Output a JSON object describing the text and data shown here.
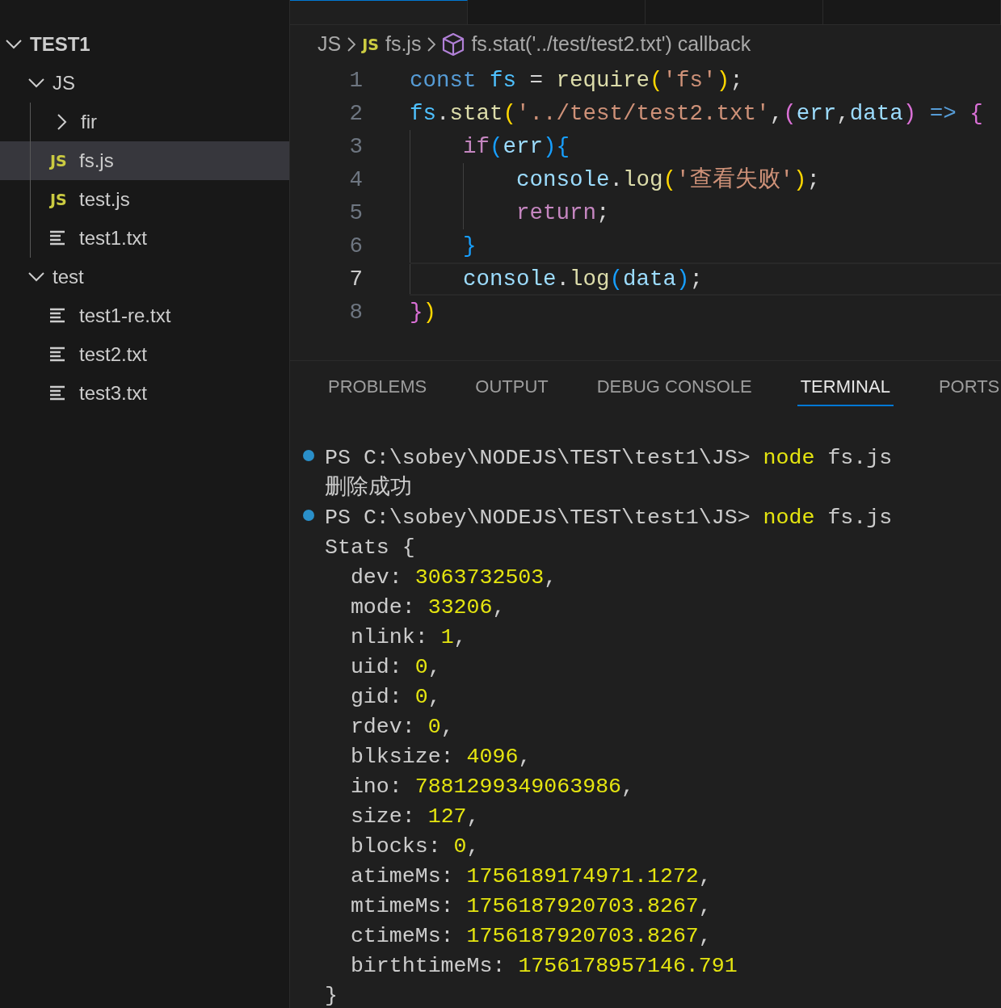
{
  "editor_tabs": [
    {
      "selected": true
    },
    {
      "selected": false
    },
    {
      "selected": false
    },
    {
      "selected": false
    }
  ],
  "explorer": {
    "root": {
      "label": "TEST1",
      "kind": "folder",
      "expanded": true,
      "selected": false,
      "children": [
        {
          "label": "JS",
          "kind": "folder",
          "expanded": true,
          "selected": false,
          "children": [
            {
              "label": "fir",
              "kind": "folder",
              "expanded": false,
              "selected": false
            },
            {
              "label": "fs.js",
              "kind": "js",
              "icon_text": "JS",
              "selected": true
            },
            {
              "label": "test.js",
              "kind": "js",
              "icon_text": "JS",
              "selected": false
            },
            {
              "label": "test1.txt",
              "kind": "txt",
              "selected": false
            }
          ]
        },
        {
          "label": "test",
          "kind": "folder",
          "expanded": true,
          "selected": false,
          "children": [
            {
              "label": "test1-re.txt",
              "kind": "txt",
              "selected": false
            },
            {
              "label": "test2.txt",
              "kind": "txt",
              "selected": false
            },
            {
              "label": "test3.txt",
              "kind": "txt",
              "selected": false
            }
          ]
        }
      ]
    }
  },
  "breadcrumb": [
    {
      "label": "JS",
      "kind": "folder"
    },
    {
      "label": "fs.js",
      "kind": "js",
      "icon_text": "JS"
    },
    {
      "label": "fs.stat('../test/test2.txt') callback",
      "kind": "symbol"
    }
  ],
  "code": {
    "lines": [
      {
        "number": "1",
        "current": false,
        "tokens": [
          {
            "t": "const ",
            "kind": "keyword"
          },
          {
            "t": "fs",
            "kind": "constant"
          },
          {
            "t": " = ",
            "kind": "plain"
          },
          {
            "t": "require",
            "kind": "function"
          },
          {
            "t": "(",
            "kind": "bracket1"
          },
          {
            "t": "'fs'",
            "kind": "string"
          },
          {
            "t": ")",
            "kind": "bracket1"
          },
          {
            "t": ";",
            "kind": "plain"
          }
        ]
      },
      {
        "number": "2",
        "current": false,
        "tokens": [
          {
            "t": "fs",
            "kind": "constant"
          },
          {
            "t": ".",
            "kind": "plain"
          },
          {
            "t": "stat",
            "kind": "function"
          },
          {
            "t": "(",
            "kind": "bracket1"
          },
          {
            "t": "'../test/test2.txt'",
            "kind": "string"
          },
          {
            "t": ",",
            "kind": "plain"
          },
          {
            "t": "(",
            "kind": "bracket2"
          },
          {
            "t": "err",
            "kind": "variable"
          },
          {
            "t": ",",
            "kind": "plain"
          },
          {
            "t": "data",
            "kind": "variable"
          },
          {
            "t": ")",
            "kind": "bracket2"
          },
          {
            "t": " =>",
            "kind": "keyword"
          },
          {
            "t": " {",
            "kind": "bracket2"
          }
        ],
        "children": [
          {
            "number": "3",
            "current": false,
            "tokens": [
              {
                "t": "if",
                "kind": "control"
              },
              {
                "t": "(",
                "kind": "bracket3"
              },
              {
                "t": "err",
                "kind": "variable"
              },
              {
                "t": ")",
                "kind": "bracket3"
              },
              {
                "t": "{",
                "kind": "bracket3"
              }
            ],
            "children": [
              {
                "number": "4",
                "current": false,
                "tokens": [
                  {
                    "t": "console",
                    "kind": "variable"
                  },
                  {
                    "t": ".",
                    "kind": "plain"
                  },
                  {
                    "t": "log",
                    "kind": "function"
                  },
                  {
                    "t": "(",
                    "kind": "bracket1"
                  },
                  {
                    "t": "'查看失败'",
                    "kind": "string"
                  },
                  {
                    "t": ")",
                    "kind": "bracket1"
                  },
                  {
                    "t": ";",
                    "kind": "plain"
                  }
                ]
              },
              {
                "number": "5",
                "current": false,
                "tokens": [
                  {
                    "t": "return",
                    "kind": "control"
                  },
                  {
                    "t": ";",
                    "kind": "plain"
                  }
                ]
              }
            ]
          },
          {
            "number": "6",
            "current": false,
            "tokens": [
              {
                "t": "}",
                "kind": "bracket3"
              }
            ]
          },
          {
            "number": "7",
            "current": true,
            "tokens": [
              {
                "t": "console",
                "kind": "variable"
              },
              {
                "t": ".",
                "kind": "plain"
              },
              {
                "t": "log",
                "kind": "function"
              },
              {
                "t": "(",
                "kind": "bracket3"
              },
              {
                "t": "data",
                "kind": "variable"
              },
              {
                "t": ")",
                "kind": "bracket3"
              },
              {
                "t": ";",
                "kind": "plain"
              }
            ]
          }
        ]
      },
      {
        "number": "8",
        "current": false,
        "tokens": [
          {
            "t": "}",
            "kind": "bracket2"
          },
          {
            "t": ")",
            "kind": "bracket1"
          }
        ]
      }
    ]
  },
  "panel": {
    "tabs": [
      {
        "label": "PROBLEMS",
        "selected": false
      },
      {
        "label": "OUTPUT",
        "selected": false
      },
      {
        "label": "DEBUG CONSOLE",
        "selected": false
      },
      {
        "label": "TERMINAL",
        "selected": true
      },
      {
        "label": "PORTS",
        "selected": false
      }
    ],
    "terminal": [
      {
        "kind": "prompt",
        "prompt": "PS C:\\sobey\\NODEJS\\TEST\\test1\\JS>",
        "command": "node",
        "args": "fs.js"
      },
      {
        "kind": "output",
        "text": "删除成功"
      },
      {
        "kind": "prompt",
        "prompt": "PS C:\\sobey\\NODEJS\\TEST\\test1\\JS>",
        "command": "node",
        "args": "fs.js"
      },
      {
        "kind": "output",
        "text": "Stats {"
      },
      {
        "kind": "field",
        "key": "dev:",
        "value": "3063732503",
        "tail": ","
      },
      {
        "kind": "field",
        "key": "mode:",
        "value": "33206",
        "tail": ","
      },
      {
        "kind": "field",
        "key": "nlink:",
        "value": "1",
        "tail": ","
      },
      {
        "kind": "field",
        "key": "uid:",
        "value": "0",
        "tail": ","
      },
      {
        "kind": "field",
        "key": "gid:",
        "value": "0",
        "tail": ","
      },
      {
        "kind": "field",
        "key": "rdev:",
        "value": "0",
        "tail": ","
      },
      {
        "kind": "field",
        "key": "blksize:",
        "value": "4096",
        "tail": ","
      },
      {
        "kind": "field",
        "key": "ino:",
        "value": "7881299349063986",
        "tail": ","
      },
      {
        "kind": "field",
        "key": "size:",
        "value": "127",
        "tail": ","
      },
      {
        "kind": "field",
        "key": "blocks:",
        "value": "0",
        "tail": ","
      },
      {
        "kind": "field",
        "key": "atimeMs:",
        "value": "1756189174971.1272",
        "tail": ","
      },
      {
        "kind": "field",
        "key": "mtimeMs:",
        "value": "1756187920703.8267",
        "tail": ","
      },
      {
        "kind": "field",
        "key": "ctimeMs:",
        "value": "1756187920703.8267",
        "tail": ","
      },
      {
        "kind": "field",
        "key": "birthtimeMs:",
        "value": "1756178957146.791"
      },
      {
        "kind": "output",
        "text": "}"
      }
    ]
  }
}
